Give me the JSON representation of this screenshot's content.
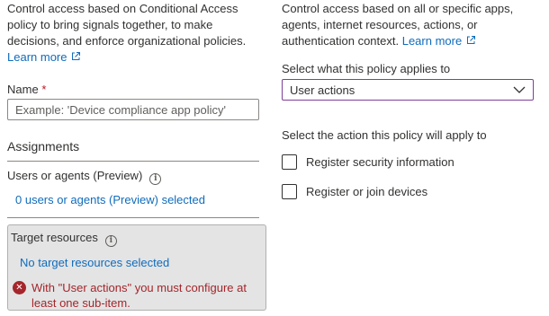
{
  "left": {
    "intro_line1": "Control access based on Conditional Access",
    "intro_line2": "policy to bring signals together, to make",
    "intro_line3": "decisions, and enforce organizational policies.",
    "learn_more": "Learn more",
    "name_label": "Name",
    "required_mark": "*",
    "name_placeholder": "Example: 'Device compliance app policy'",
    "name_value": "",
    "assignments_title": "Assignments",
    "users_label": "Users or agents (Preview)",
    "users_link": "0 users or agents (Preview) selected",
    "target_label": "Target resources",
    "target_link": "No target resources selected",
    "error_line1": "With \"User actions\" you must configure at",
    "error_line2": "least one sub-item."
  },
  "right": {
    "intro_line1": "Control access based on all or specific apps,",
    "intro_line2": "agents, internet resources, actions, or",
    "intro_line3": "authentication context.",
    "learn_more": "Learn more",
    "applies_label": "Select what this policy applies to",
    "applies_selected": "User actions",
    "action_label": "Select the action this policy will apply to",
    "checkboxes": [
      {
        "label": "Register security information",
        "checked": false
      },
      {
        "label": "Register or join devices",
        "checked": false
      }
    ]
  },
  "icons": {
    "external_link": "external-link-icon",
    "info": "info-icon",
    "error": "error-circle-icon",
    "chevron": "chevron-down-icon"
  },
  "colors": {
    "link": "#0f6cbd",
    "error": "#a4262c",
    "required": "#c50f1f",
    "dropdown_border": "#7f3f98",
    "target_box_bg": "#e4e4e4"
  }
}
